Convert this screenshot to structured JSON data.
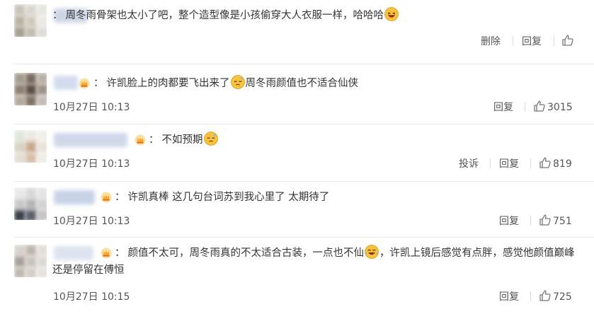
{
  "comments": [
    {
      "text": "周冬雨骨架也太小了吧，整个造型像是小孩偷穿大人衣服一样，哈哈哈",
      "emoji": "laughing-emoji",
      "actions": [
        "删除",
        "回复"
      ],
      "like_count": ""
    },
    {
      "text_a": "许凯脸上的肉都要飞出来了",
      "emoji": "sweat-emoji",
      "text_b": "周冬雨颜值也不适合仙侠",
      "time": "10月27日 10:13",
      "actions": [
        "回复"
      ],
      "like_count": "3015"
    },
    {
      "text": "不如预期",
      "emoji": "sweat-emoji",
      "time": "10月27日 10:13",
      "actions": [
        "投诉",
        "回复"
      ],
      "like_count": "819"
    },
    {
      "text": "许凯真棒 这几句台词苏到我心里了 太期待了",
      "time": "10月27日 10:13",
      "actions": [
        "回复"
      ],
      "like_count": "751"
    },
    {
      "text_a": "颜值不太可，周冬雨真的不太适合古装，一点也不仙",
      "emoji": "tears-of-joy-emoji",
      "text_b": "，许凯上镜后感觉有点胖，感觉他颜值巅峰还是停留在傅恒",
      "time": "10月27日 10:15",
      "actions": [
        "回复"
      ],
      "like_count": "725"
    }
  ],
  "colors": {
    "text": "#333333",
    "meta": "#555555",
    "divider": "#e8e8e8",
    "crown": "#f5a623",
    "emoji_face": "#f7c23c"
  }
}
